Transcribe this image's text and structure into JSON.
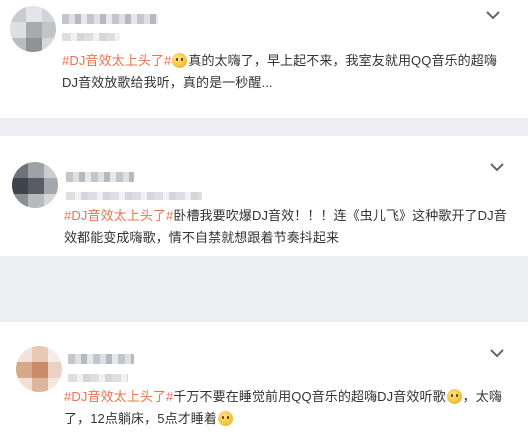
{
  "posts": [
    {
      "hashtag": "#DJ音效太上头了#",
      "text_before_emoji": "",
      "emoji": "laugh-emoji",
      "text_after_emoji": "真的太嗨了，早上起不来，我室友就用QQ音乐的超嗨DJ音效放歌给我听，真的是一秒醒...",
      "text_after_emoji_2": ""
    },
    {
      "hashtag": "#DJ音效太上头了#",
      "text_before_emoji": "卧槽我要吹爆DJ音效！！！连《虫儿飞》这种歌开了DJ音效都能变成嗨歌，情不自禁就想跟着节奏抖起来",
      "emoji": "",
      "text_after_emoji": "",
      "text_after_emoji_2": ""
    },
    {
      "hashtag": "#DJ音效太上头了#",
      "text_before_emoji": "千万不要在睡觉前用QQ音乐的超嗨DJ音效听歌",
      "emoji": "laugh-emoji",
      "text_after_emoji": "，太嗨了，12点躺床，5点才睡着",
      "text_after_emoji_2": ""
    }
  ],
  "icons": {
    "more": "chevron-down-icon",
    "avatar": "blurred-avatar"
  },
  "colors": {
    "hashtag": "#eb7350",
    "text": "#333333",
    "page_bg": "#eceef1",
    "card_bg": "#ffffff"
  }
}
